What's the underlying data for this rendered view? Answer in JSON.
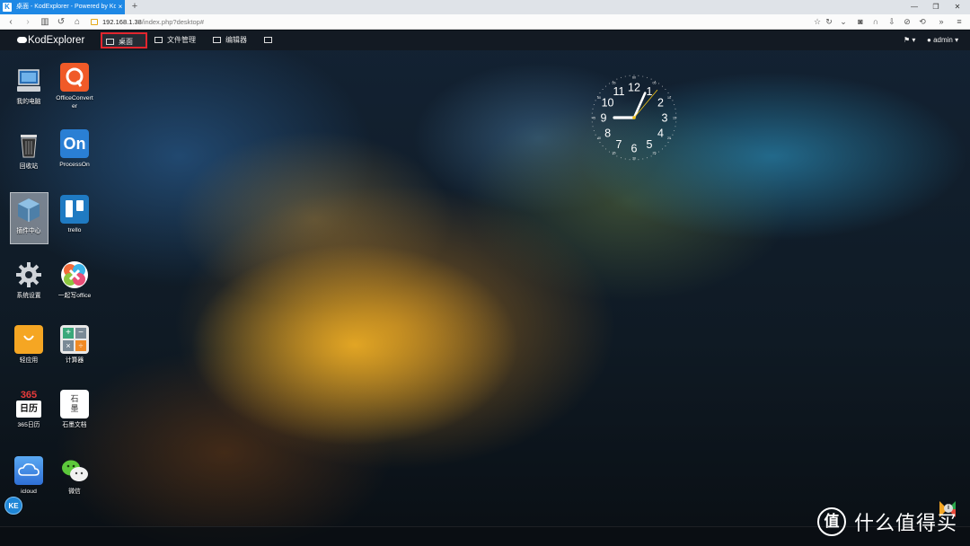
{
  "browser": {
    "tab_title": "桌面 - KodExplorer - Powered by Ko",
    "tab_close": "×",
    "new_tab": "+",
    "url_host": "192.168.1.38",
    "url_path": "/index.php?desktop#"
  },
  "app": {
    "logo": "KodExplorer",
    "menu": [
      {
        "label": "桌面"
      },
      {
        "label": "文件管理"
      },
      {
        "label": "编辑器"
      }
    ],
    "user": "admin"
  },
  "desktop_icons": [
    {
      "label": "我的电脑"
    },
    {
      "label": "OfficeConverter"
    },
    {
      "label": "回收站"
    },
    {
      "label": "ProcessOn"
    },
    {
      "label": "插件中心"
    },
    {
      "label": "trello"
    },
    {
      "label": "系统设置"
    },
    {
      "label": "一起写office"
    },
    {
      "label": "轻应用"
    },
    {
      "label": "计算器"
    },
    {
      "label": "365日历"
    },
    {
      "label": "石墨文档"
    },
    {
      "label": "icloud"
    },
    {
      "label": "微信"
    }
  ],
  "icon_glyphs": {
    "processon": "On",
    "calendar_top": "365",
    "calendar_bottom": "日历",
    "shimo": "石墨"
  },
  "clock": {
    "numbers": [
      "12",
      "1",
      "2",
      "3",
      "4",
      "5",
      "6",
      "7",
      "8",
      "9",
      "10",
      "11"
    ],
    "minute_marks": [
      "60",
      "05",
      "10",
      "15",
      "20",
      "25",
      "30",
      "35",
      "40",
      "45",
      "50",
      "55"
    ]
  },
  "taskbar": {
    "start": "KE",
    "info": "i"
  },
  "watermark": {
    "symbol": "值",
    "text": "什么值得买"
  },
  "colors": {
    "tab_blue": "#1e88e5",
    "menu_active_border": "#e3262e",
    "menubar_bg": "#141a22"
  }
}
